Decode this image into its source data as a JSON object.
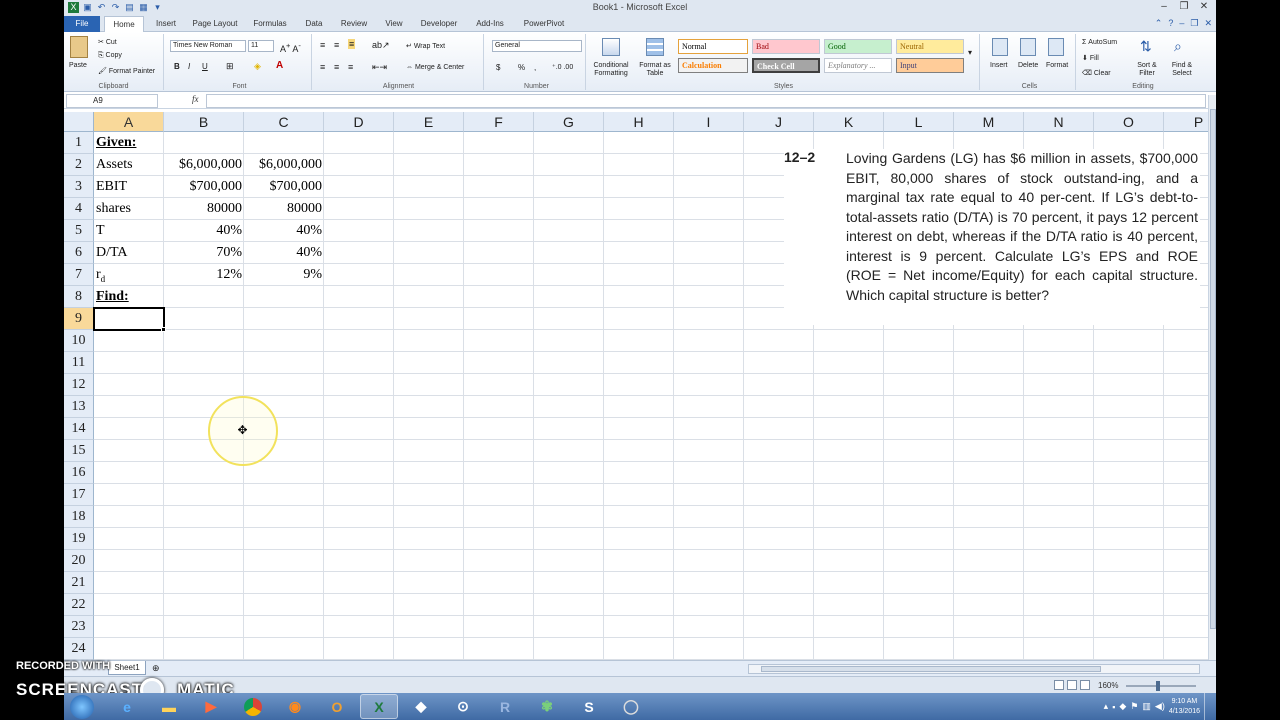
{
  "window": {
    "title": "Book1 - Microsoft Excel"
  },
  "ribbon": {
    "tabs": [
      "File",
      "Home",
      "Insert",
      "Page Layout",
      "Formulas",
      "Data",
      "Review",
      "View",
      "Developer",
      "Add-Ins",
      "PowerPivot"
    ],
    "active_tab": "Home",
    "clipboard": {
      "paste": "Paste",
      "cut": "Cut",
      "copy": "Copy",
      "format_painter": "Format Painter",
      "label": "Clipboard"
    },
    "font": {
      "name": "Times New Roman",
      "size": "11",
      "bold": "B",
      "italic": "I",
      "underline": "U",
      "label": "Font"
    },
    "alignment": {
      "wrap_text": "Wrap Text",
      "merge_center": "Merge & Center",
      "label": "Alignment"
    },
    "number": {
      "format": "General",
      "currency": "$",
      "percent": "%",
      "comma": ",",
      "label": "Number"
    },
    "styles": {
      "conditional": "Conditional Formatting",
      "format_table": "Format as Table",
      "normal": "Normal",
      "bad": "Bad",
      "good": "Good",
      "neutral": "Neutral",
      "calculation": "Calculation",
      "check_cell": "Check Cell",
      "explanatory": "Explanatory ...",
      "input": "Input",
      "label": "Styles"
    },
    "cells": {
      "insert": "Insert",
      "delete": "Delete",
      "format": "Format",
      "label": "Cells"
    },
    "editing": {
      "autosum": "AutoSum",
      "fill": "Fill",
      "clear": "Clear",
      "sort_filter": "Sort & Filter",
      "find_select": "Find & Select",
      "label": "Editing"
    }
  },
  "formula_bar": {
    "name_box": "A9",
    "fx": "fx",
    "content": ""
  },
  "sheet": {
    "columns": [
      "A",
      "B",
      "C",
      "D",
      "E",
      "F",
      "G",
      "H",
      "I",
      "J",
      "K",
      "L",
      "M",
      "N",
      "O",
      "P"
    ],
    "rows": [
      "1",
      "2",
      "3",
      "4",
      "5",
      "6",
      "7",
      "8",
      "9",
      "10",
      "11",
      "12",
      "13",
      "14",
      "15",
      "16",
      "17",
      "18",
      "19",
      "20",
      "21",
      "22",
      "23",
      "24"
    ],
    "active_cell": "A9",
    "cells": {
      "a1": "Given:",
      "a2": "Assets",
      "b2": "$6,000,000",
      "c2": "$6,000,000",
      "a3": "EBIT",
      "b3": "$700,000",
      "c3": "$700,000",
      "a4": "shares",
      "b4": "80000",
      "c4": "80000",
      "a5": "T",
      "b5": "40%",
      "c5": "40%",
      "a6": "D/TA",
      "b6": "70%",
      "c6": "40%",
      "a7_main": "r",
      "a7_sub": "d",
      "b7": "12%",
      "c7": "9%",
      "a8": "Find:"
    },
    "tab_name": "Sheet1"
  },
  "problem": {
    "number": "12–2",
    "text": "Loving Gardens (LG) has $6 million in assets, $700,000 EBIT, 80,000 shares of stock outstand-ing, and a marginal tax rate equal to 40 per-cent. If LG’s debt-to-total-assets ratio (D/TA) is 70 percent, it pays 12 percent interest on debt, whereas if the D/TA ratio is 40 percent, interest is 9 percent. Calculate LG’s EPS and ROE (ROE = Net income/Equity) for each capital structure. Which capital structure is better?"
  },
  "status_bar": {
    "zoom": "160%"
  },
  "watermark": {
    "line1": "RECORDED WITH",
    "line2": "SCREENCAST",
    "line3": "MATIC"
  },
  "taskbar": {
    "time": "9:10 AM",
    "date": "4/13/2016"
  }
}
